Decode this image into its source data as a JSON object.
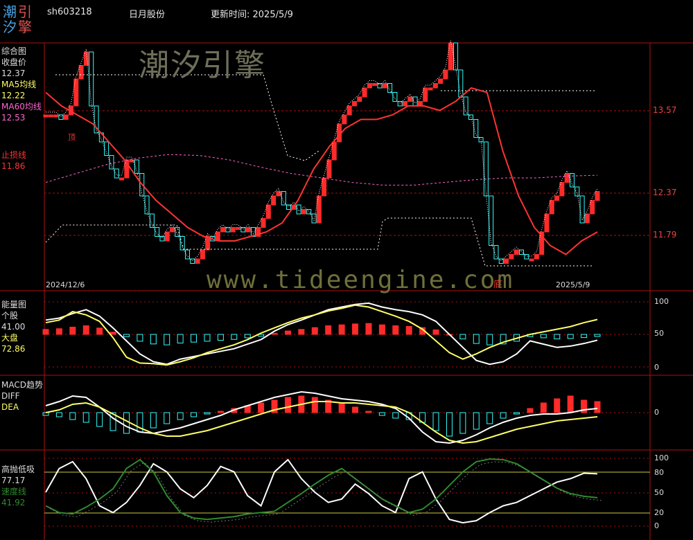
{
  "header": {
    "logo_chars": [
      "潮",
      "引",
      "汐",
      "擎"
    ],
    "stock_code": "sh603218",
    "stock_name": "日月股份",
    "update_label": "更新时间: 2025/5/9"
  },
  "watermarks": {
    "brand": "潮汐引擎",
    "url": "www.tideengine.com"
  },
  "colors": {
    "up": "#ff2a2a",
    "down": "#33ffff",
    "ma5": "#ffff66",
    "ma60": "#ff66cc",
    "stop": "#ff3333",
    "grid": "#b01010",
    "white_line": "#ffffff",
    "speed_line": "#2e8b2e"
  },
  "panel_price": {
    "labels": [
      {
        "text": "综合图",
        "color": "#dddddd"
      },
      {
        "text": "收盘价",
        "color": "#dddddd"
      },
      {
        "text": "12.37",
        "color": "#dddddd"
      },
      {
        "text": "MA5均线",
        "color": "#ffff66"
      },
      {
        "text": "12.22",
        "color": "#ffff66"
      },
      {
        "text": "MA60均线",
        "color": "#ff66cc"
      },
      {
        "text": "12.53",
        "color": "#ff66cc"
      },
      {
        "text": "止损线",
        "color": "#ff3333"
      },
      {
        "text": "11.86",
        "color": "#ff3333"
      }
    ],
    "right_ticks": [
      "13.57",
      "12.37",
      "11.79"
    ],
    "date_start": "2024/12/6",
    "date_end": "2025/5/9",
    "annotation_bottom": "底",
    "annotation_top": "顶"
  },
  "panel_energy": {
    "labels": [
      {
        "text": "能量图",
        "color": "#dddddd"
      },
      {
        "text": "个股",
        "color": "#dddddd"
      },
      {
        "text": "41.00",
        "color": "#dddddd"
      },
      {
        "text": "大盘",
        "color": "#ffff66"
      },
      {
        "text": "72.86",
        "color": "#ffff66"
      }
    ],
    "right_ticks": [
      "100",
      "50",
      "0"
    ]
  },
  "panel_macd": {
    "labels": [
      {
        "text": "MACD趋势",
        "color": "#dddddd"
      },
      {
        "text": "DIFF",
        "color": "#dddddd"
      },
      {
        "text": "DEA",
        "color": "#ffff66"
      }
    ],
    "right_ticks": [
      "0"
    ]
  },
  "panel_osc": {
    "labels": [
      {
        "text": "高抛低吸",
        "color": "#dddddd"
      },
      {
        "text": "77.17",
        "color": "#dddddd"
      },
      {
        "text": "速度线",
        "color": "#2e8b2e"
      },
      {
        "text": "41.92",
        "color": "#2e8b2e"
      }
    ],
    "right_ticks": [
      "100",
      "80",
      "50",
      "20",
      "0"
    ]
  },
  "chart_data": {
    "type": "candlestick",
    "title": "日月股份",
    "x_range": [
      "2024/12/6",
      "2025/5/9"
    ],
    "price_ylim": [
      11.4,
      14.0
    ],
    "closes": [
      13.2,
      13.2,
      13.2,
      13.15,
      13.2,
      13.3,
      13.6,
      13.75,
      13.9,
      13.3,
      13.0,
      12.9,
      12.75,
      12.6,
      12.5,
      12.5,
      12.7,
      12.7,
      12.55,
      12.3,
      12.1,
      11.95,
      11.85,
      11.8,
      11.9,
      11.95,
      11.85,
      11.7,
      11.6,
      11.55,
      11.6,
      11.7,
      11.85,
      11.8,
      11.9,
      11.95,
      11.9,
      11.95,
      11.95,
      11.9,
      11.95,
      11.85,
      11.95,
      12.05,
      12.2,
      12.3,
      12.35,
      12.2,
      12.15,
      12.2,
      12.1,
      12.15,
      12.1,
      12.0,
      12.3,
      12.5,
      12.7,
      12.9,
      13.1,
      13.2,
      13.3,
      13.35,
      13.4,
      13.5,
      13.55,
      13.55,
      13.5,
      13.55,
      13.45,
      13.35,
      13.3,
      13.35,
      13.4,
      13.3,
      13.35,
      13.5,
      13.5,
      13.55,
      13.6,
      13.7,
      14.0,
      13.7,
      13.4,
      13.2,
      13.15,
      12.95,
      12.9,
      12.3,
      11.75,
      11.6,
      11.55,
      11.6,
      11.65,
      11.7,
      11.65,
      11.6,
      11.6,
      11.65,
      11.9,
      12.1,
      12.25,
      12.3,
      12.45,
      12.55,
      12.4,
      12.3,
      12.0,
      12.1,
      12.25,
      12.35
    ],
    "stop_line": [
      13.45,
      13.3,
      13.2,
      13.1,
      12.9,
      12.7,
      12.45,
      12.25,
      12.1,
      11.95,
      11.85,
      11.8,
      11.8,
      11.85,
      11.9,
      12.0,
      12.25,
      12.6,
      12.85,
      13.05,
      13.15,
      13.15,
      13.2,
      13.3,
      13.3,
      13.25,
      13.35,
      13.5,
      13.45,
      12.8,
      12.3,
      11.95,
      11.75,
      11.65,
      11.8,
      11.9
    ],
    "ma60": [
      12.45,
      12.55,
      12.65,
      12.72,
      12.76,
      12.75,
      12.7,
      12.62,
      12.55,
      12.5,
      12.45,
      12.42,
      12.42,
      12.45,
      12.48,
      12.5,
      12.5,
      12.52,
      12.53
    ],
    "energy_stock": [
      72,
      75,
      82,
      88,
      78,
      60,
      40,
      20,
      8,
      4,
      12,
      16,
      20,
      24,
      28,
      35,
      42,
      55,
      65,
      72,
      80,
      88,
      92,
      96,
      98,
      92,
      88,
      85,
      80,
      70,
      50,
      30,
      10,
      4,
      8,
      20,
      40,
      35,
      30,
      32,
      36,
      41
    ],
    "energy_market": [
      68,
      72,
      85,
      80,
      70,
      45,
      15,
      6,
      5,
      3,
      8,
      14,
      22,
      28,
      34,
      42,
      52,
      60,
      68,
      75,
      80,
      86,
      90,
      95,
      92,
      85,
      78,
      70,
      58,
      40,
      22,
      12,
      20,
      30,
      38,
      44,
      50,
      54,
      58,
      62,
      68,
      72.86
    ],
    "osc_fast": [
      50,
      85,
      95,
      70,
      30,
      20,
      35,
      60,
      92,
      80,
      55,
      42,
      60,
      88,
      80,
      45,
      30,
      80,
      98,
      70,
      50,
      35,
      40,
      62,
      48,
      30,
      20,
      70,
      80,
      40,
      10,
      5,
      8,
      20,
      30,
      35,
      45,
      55,
      65,
      70,
      78,
      77.17
    ],
    "osc_speed": [
      30,
      20,
      18,
      28,
      40,
      55,
      85,
      98,
      80,
      45,
      20,
      12,
      10,
      12,
      14,
      18,
      20,
      22,
      35,
      48,
      62,
      75,
      85,
      70,
      55,
      40,
      30,
      20,
      25,
      40,
      60,
      80,
      95,
      99,
      98,
      92,
      80,
      68,
      56,
      48,
      44,
      41.92
    ]
  }
}
